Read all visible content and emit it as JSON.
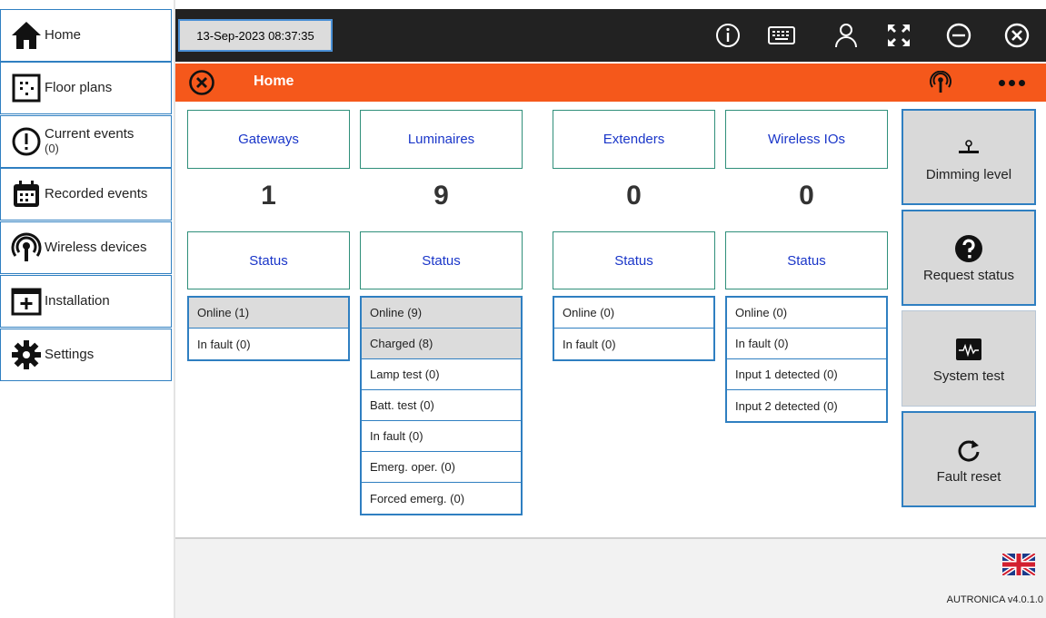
{
  "sidebar": {
    "items": [
      {
        "label": "Home",
        "icon": "home-icon"
      },
      {
        "label": "Floor plans",
        "icon": "floor-plan-icon"
      },
      {
        "label": "Current events",
        "count": "(0)",
        "icon": "alert-icon"
      },
      {
        "label": "Recorded events",
        "icon": "calendar-icon"
      },
      {
        "label": "Wireless devices",
        "icon": "wireless-icon"
      },
      {
        "label": "Installation",
        "icon": "installation-icon"
      },
      {
        "label": "Settings",
        "icon": "gear-icon"
      }
    ]
  },
  "topbar": {
    "datetime": "13-Sep-2023 08:37:35",
    "icons": [
      "info-icon",
      "keyboard-icon",
      "user-icon",
      "fullscreen-icon",
      "minimize-icon",
      "close-icon"
    ]
  },
  "header": {
    "title": "Home",
    "colors": {
      "accent": "#f5581b",
      "dark": "#222222",
      "border": "#2f7fc1",
      "link": "#1a36c9"
    }
  },
  "columns": [
    {
      "title": "Gateways",
      "count": "1",
      "status_label": "Status",
      "rows": [
        {
          "label": "Online  (1)",
          "highlight": true
        },
        {
          "label": "In fault  (0)",
          "highlight": false
        }
      ]
    },
    {
      "title": "Luminaires",
      "count": "9",
      "status_label": "Status",
      "rows": [
        {
          "label": "Online  (9)",
          "highlight": true
        },
        {
          "label": "Charged  (8)",
          "highlight": true
        },
        {
          "label": "Lamp test  (0)",
          "highlight": false
        },
        {
          "label": "Batt. test  (0)",
          "highlight": false
        },
        {
          "label": "In fault  (0)",
          "highlight": false
        },
        {
          "label": "Emerg. oper.  (0)",
          "highlight": false
        },
        {
          "label": "Forced emerg. (0)",
          "highlight": false
        }
      ]
    },
    {
      "title": "Extenders",
      "count": "0",
      "status_label": "Status",
      "rows": [
        {
          "label": "Online  (0)",
          "highlight": false
        },
        {
          "label": "In fault  (0)",
          "highlight": false
        }
      ]
    },
    {
      "title": "Wireless IOs",
      "count": "0",
      "status_label": "Status",
      "rows": [
        {
          "label": "Online  (0)",
          "highlight": false
        },
        {
          "label": "In fault  (0)",
          "highlight": false
        },
        {
          "label": "Input 1 detected  (0)",
          "highlight": false
        },
        {
          "label": "Input 2 detected  (0)",
          "highlight": false
        }
      ]
    }
  ],
  "actions": [
    {
      "label": "Dimming level",
      "icon": "dimming-icon"
    },
    {
      "label": "Request status",
      "icon": "question-icon"
    },
    {
      "label": "System test",
      "icon": "system-test-icon"
    },
    {
      "label": "Fault reset",
      "icon": "refresh-icon"
    }
  ],
  "footer": {
    "version": "AUTRONICA v4.0.1.0",
    "language_icon": "uk-flag-icon"
  }
}
